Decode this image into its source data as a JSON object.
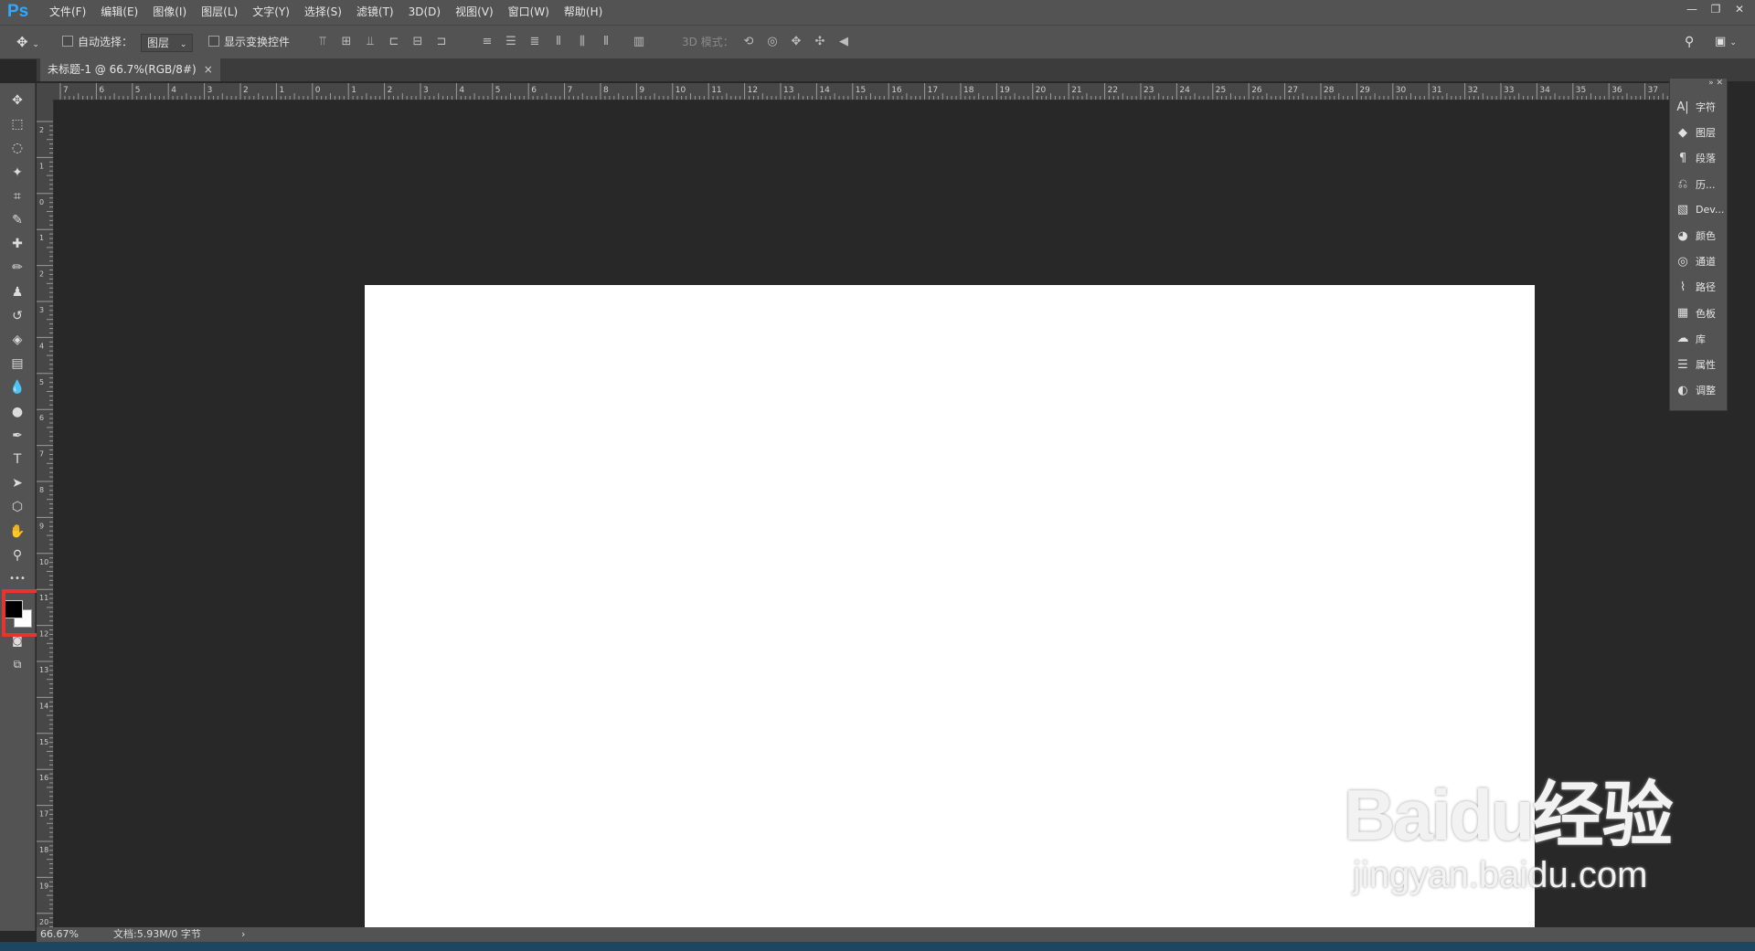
{
  "app": {
    "logo": "Ps"
  },
  "menu": [
    "文件(F)",
    "编辑(E)",
    "图像(I)",
    "图层(L)",
    "文字(Y)",
    "选择(S)",
    "滤镜(T)",
    "3D(D)",
    "视图(V)",
    "窗口(W)",
    "帮助(H)"
  ],
  "window_controls": [
    "—",
    "❐",
    "✕"
  ],
  "options": {
    "auto_select_label": "自动选择：",
    "auto_select_value": "图层",
    "show_transform_label": "显示变换控件",
    "mode_3d_label": "3D 模式："
  },
  "document_tab": {
    "title": "未标题-1 @ 66.7%(RGB/8#)",
    "close": "×"
  },
  "tools": [
    {
      "name": "move-tool",
      "glyph": "✥"
    },
    {
      "name": "marquee-tool",
      "glyph": "⬚"
    },
    {
      "name": "lasso-tool",
      "glyph": "◌"
    },
    {
      "name": "magic-wand-tool",
      "glyph": "✦"
    },
    {
      "name": "crop-tool",
      "glyph": "⌗"
    },
    {
      "name": "eyedropper-tool",
      "glyph": "✎"
    },
    {
      "name": "healing-tool",
      "glyph": "✚"
    },
    {
      "name": "brush-tool",
      "glyph": "✏"
    },
    {
      "name": "stamp-tool",
      "glyph": "♟"
    },
    {
      "name": "history-brush-tool",
      "glyph": "↺"
    },
    {
      "name": "eraser-tool",
      "glyph": "◈"
    },
    {
      "name": "gradient-tool",
      "glyph": "▤"
    },
    {
      "name": "blur-tool",
      "glyph": "💧"
    },
    {
      "name": "dodge-tool",
      "glyph": "●"
    },
    {
      "name": "pen-tool",
      "glyph": "✒"
    },
    {
      "name": "type-tool",
      "glyph": "T"
    },
    {
      "name": "path-select-tool",
      "glyph": "➤"
    },
    {
      "name": "shape-tool",
      "glyph": "⬡"
    },
    {
      "name": "hand-tool",
      "glyph": "✋"
    },
    {
      "name": "zoom-tool",
      "glyph": "⚲"
    },
    {
      "name": "more-tools",
      "glyph": "•••"
    }
  ],
  "ruler_h": [
    "7",
    "6",
    "5",
    "4",
    "3",
    "2",
    "1",
    "0",
    "1",
    "2",
    "3",
    "4",
    "5",
    "6",
    "7",
    "8",
    "9",
    "10",
    "11",
    "12",
    "13",
    "14",
    "15",
    "16",
    "17",
    "18",
    "19",
    "20",
    "21",
    "22",
    "23",
    "24",
    "25",
    "26",
    "27",
    "28",
    "29",
    "30",
    "31",
    "32",
    "33",
    "34",
    "35",
    "36",
    "37"
  ],
  "ruler_v": [
    "2",
    "1",
    "0",
    "1",
    "2",
    "3",
    "4",
    "5",
    "6",
    "7",
    "8",
    "9",
    "10",
    "11",
    "12",
    "13",
    "14",
    "15",
    "16",
    "17",
    "18",
    "19",
    "20"
  ],
  "panels": [
    {
      "icon": "A|",
      "label": "字符"
    },
    {
      "icon": "◆",
      "label": "图层"
    },
    {
      "icon": "¶",
      "label": "段落"
    },
    {
      "icon": "⎌",
      "label": "历..."
    },
    {
      "icon": "▧",
      "label": "Dev..."
    },
    {
      "icon": "◕",
      "label": "颜色"
    },
    {
      "icon": "◎",
      "label": "通道"
    },
    {
      "icon": "⌇",
      "label": "路径"
    },
    {
      "icon": "▦",
      "label": "色板"
    },
    {
      "icon": "☁",
      "label": "库"
    },
    {
      "icon": "☰",
      "label": "属性"
    },
    {
      "icon": "◐",
      "label": "调整"
    }
  ],
  "status": {
    "zoom": "66.67%",
    "doc_info": "文档:5.93M/0 字节",
    "arrow": "›"
  },
  "watermark": {
    "main": "Baidu经验",
    "sub": "jingyan.baidu.com"
  },
  "colors": {
    "accent": "#31a8ff",
    "highlight": "#e8342f",
    "canvas": "#ffffff"
  }
}
